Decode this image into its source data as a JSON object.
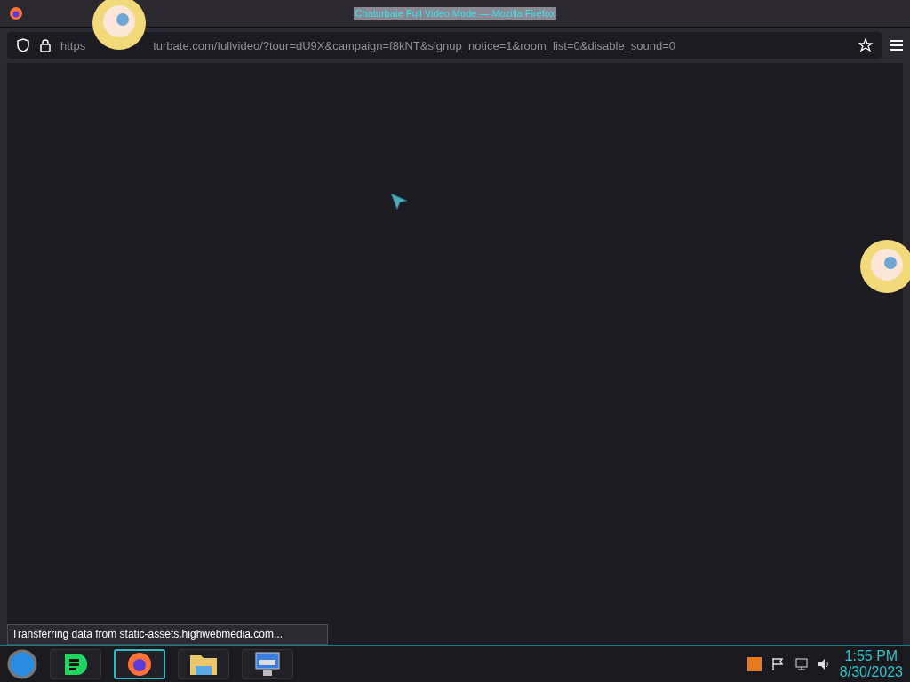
{
  "window": {
    "title": "Chaturbate Full Video Mode — Mozilla Firefox"
  },
  "address_bar": {
    "url_start": "https",
    "url_end": "turbate.com/fullvideo/?tour=dU9X&campaign=f8kNT&signup_notice=1&room_list=0&disable_sound=0"
  },
  "status_bar": {
    "text": "Transferring data from static-assets.highwebmedia.com..."
  },
  "taskbar": {
    "apps": [
      {
        "kind": "chat",
        "selected": false
      },
      {
        "kind": "browser",
        "selected": true
      },
      {
        "kind": "folder",
        "selected": false
      },
      {
        "kind": "computer",
        "selected": false
      }
    ],
    "clock": {
      "time": "1:55 PM",
      "date": "8/30/2023"
    }
  }
}
